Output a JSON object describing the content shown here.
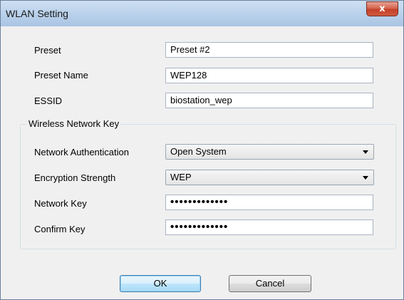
{
  "window": {
    "title": "WLAN Setting",
    "close_glyph": "x"
  },
  "fields": {
    "preset": {
      "label": "Preset",
      "value": "Preset #2"
    },
    "preset_name": {
      "label": "Preset Name",
      "value": "WEP128"
    },
    "essid": {
      "label": "ESSID",
      "value": "biostation_wep"
    }
  },
  "wireless_key": {
    "group_label": "Wireless Network Key",
    "network_authentication": {
      "label": "Network Authentication",
      "selected": "Open System"
    },
    "encryption_strength": {
      "label": "Encryption Strength",
      "selected": "WEP"
    },
    "network_key": {
      "label": "Network Key",
      "value": "•••••••••••••"
    },
    "confirm_key": {
      "label": "Confirm Key",
      "value": "•••••••••••••"
    }
  },
  "buttons": {
    "ok": "OK",
    "cancel": "Cancel"
  }
}
